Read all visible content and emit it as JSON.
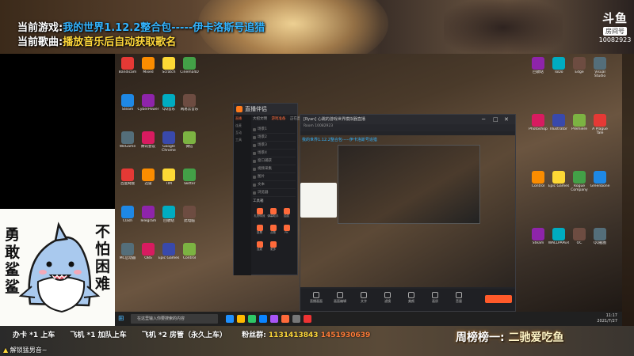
{
  "overlay": {
    "game_label": "当前游戏:",
    "game_value": "我的世界1.12.2整合包-----伊卡洛斯号追猎",
    "song_label": "当前歌曲:",
    "song_value": "播放音乐后自动获取歌名"
  },
  "platform_logo": {
    "glyph": "斗鱼",
    "sub": "房间号",
    "room_id": "10082923"
  },
  "sticker": {
    "left_text": "勇敢鲨鲨",
    "right_text": "不怕困难"
  },
  "live_window": {
    "title": "直播伴侣",
    "tabs": [
      "大招文明",
      "游戏准备",
      "正在直播"
    ],
    "side_items": [
      "直播",
      "连麦",
      "互动",
      "工具"
    ],
    "scenes": [
      "场景1",
      "场景2",
      "场景3",
      "场景4",
      "窗口捕获",
      "视频采集",
      "图片",
      "文本",
      "浏览器"
    ],
    "tools_title": "工具箱",
    "tools": [
      "礼物特效",
      "弹幕助手",
      "抽奖",
      "投票",
      "点歌",
      "PK",
      "连麦",
      "更多"
    ]
  },
  "preview_window": {
    "title": "[Ryan] 心跳的游戏世界模拟器直播",
    "subtitle": "Room 10082923",
    "controls": [
      "直播画面",
      "画面编辑",
      "文字",
      "滤镜",
      "美颜",
      "画质",
      "音量"
    ]
  },
  "taskbar": {
    "search_placeholder": "在这里输入你要搜索的内容",
    "clock_time": "11:17",
    "clock_date": "2021/7/27"
  },
  "bottom_bar": {
    "gift1": "办卡 *1 上车",
    "gift2": "飞机 *1 加队上车",
    "gift3": "飞机 *2 房管（永久上车）",
    "qq_label": "粉丝群:",
    "qq1": "1131413843",
    "qq2": "1451930639",
    "weekly_label": "周榜榜一:",
    "weekly_value": "二驰爱吃鱼",
    "unlock_hint": "解锁猛男音~"
  },
  "desktop_icons": [
    "Bandicam",
    "Mixed",
    "Scratch",
    "Cinema4D",
    "Steam",
    "CyberPower",
    "QQ音乐",
    "网易云音乐",
    "WeGame",
    "腾讯会议",
    "Google Chrome",
    "微信",
    "百度网盘",
    "迅雷",
    "TIM",
    "Twitter",
    "Clash",
    "Telegram",
    "回收站",
    "此电脑",
    "MC启动器",
    "OBS",
    "Epic Games",
    "Control"
  ],
  "right_icons": [
    "回收站",
    "ToDo",
    "Edge",
    "Visual Studio",
    "Photoshop",
    "Illustrator",
    "Premiere",
    "A Plague Tale",
    "Control",
    "Epic Games",
    "Rogue Company",
    "Greenbone",
    "Steam",
    "WALLPAPER",
    "OC",
    "QQ截图"
  ]
}
